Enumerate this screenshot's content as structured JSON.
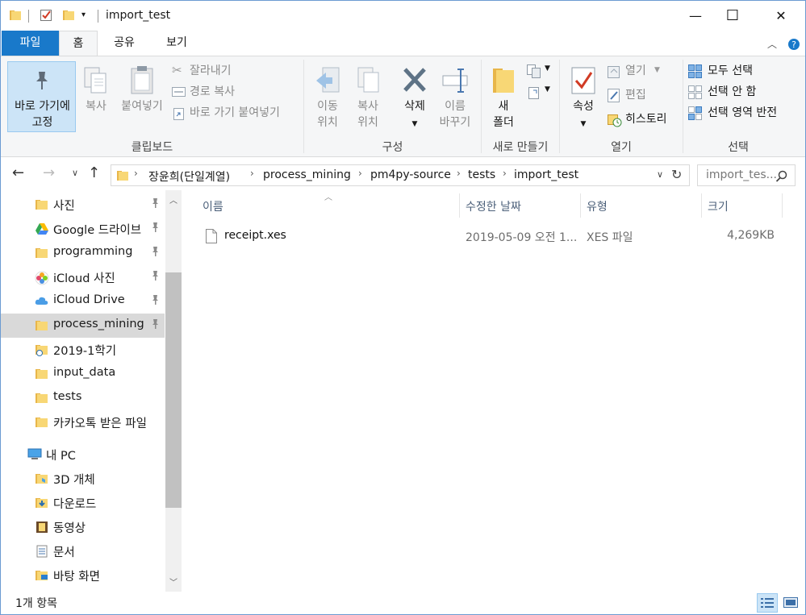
{
  "window": {
    "title": "import_test",
    "minimize_glyph": "—",
    "maximize_glyph": "☐",
    "close_glyph": "✕"
  },
  "tabs": {
    "file": "파일",
    "home": "홈",
    "share": "공유",
    "view": "보기"
  },
  "ribbon": {
    "clipboard": {
      "pin_quick_access_line1": "바로 가기에",
      "pin_quick_access_line2": "고정",
      "copy": "복사",
      "paste": "붙여넣기",
      "cut": "잘라내기",
      "copy_path": "경로 복사",
      "paste_shortcut": "바로 가기 붙여넣기",
      "group_label": "클립보드"
    },
    "organize": {
      "move_to_line1": "이동",
      "move_to_line2": "위치",
      "copy_to_line1": "복사",
      "copy_to_line2": "위치",
      "delete": "삭제",
      "rename_line1": "이름",
      "rename_line2": "바꾸기",
      "group_label": "구성"
    },
    "new": {
      "new_folder_line1": "새",
      "new_folder_line2": "폴더",
      "group_label": "새로 만들기"
    },
    "open": {
      "properties": "속성",
      "open": "열기",
      "edit": "편집",
      "history": "히스토리",
      "group_label": "열기"
    },
    "select": {
      "select_all": "모두 선택",
      "select_none": "선택 안 함",
      "invert_selection": "선택 영역 반전",
      "group_label": "선택"
    }
  },
  "address": {
    "crumbs": [
      "장윤희(단일계열)",
      "process_mining",
      "pm4py-source",
      "tests",
      "import_test"
    ],
    "search_placeholder": "import_tes..."
  },
  "nav": {
    "items": [
      {
        "label": "사진",
        "pinned": true
      },
      {
        "label": "Google 드라이브",
        "pinned": true
      },
      {
        "label": "programming",
        "pinned": true
      },
      {
        "label": "iCloud 사진",
        "pinned": true
      },
      {
        "label": "iCloud Drive",
        "pinned": true
      },
      {
        "label": "process_mining",
        "pinned": true,
        "selected": true
      },
      {
        "label": "2019-1학기",
        "pinned": false
      },
      {
        "label": "input_data",
        "pinned": false
      },
      {
        "label": "tests",
        "pinned": false
      },
      {
        "label": "카카오톡 받은 파일",
        "pinned": false
      },
      {
        "label": "내 PC",
        "pinned": false
      },
      {
        "label": "3D 개체",
        "pinned": false
      },
      {
        "label": "다운로드",
        "pinned": false
      },
      {
        "label": "동영상",
        "pinned": false
      },
      {
        "label": "문서",
        "pinned": false
      },
      {
        "label": "바탕 화면",
        "pinned": false
      }
    ]
  },
  "columns": {
    "name": "이름",
    "modified": "수정한 날짜",
    "type": "유형",
    "size": "크기"
  },
  "files": [
    {
      "name": "receipt.xes",
      "modified": "2019-05-09 오전 1...",
      "type": "XES 파일",
      "size": "4,269KB"
    }
  ],
  "status": {
    "item_count": "1개 항목"
  },
  "colors": {
    "accent": "#1979ca",
    "folder": "#f8d775",
    "selection": "#d9d9d9"
  }
}
